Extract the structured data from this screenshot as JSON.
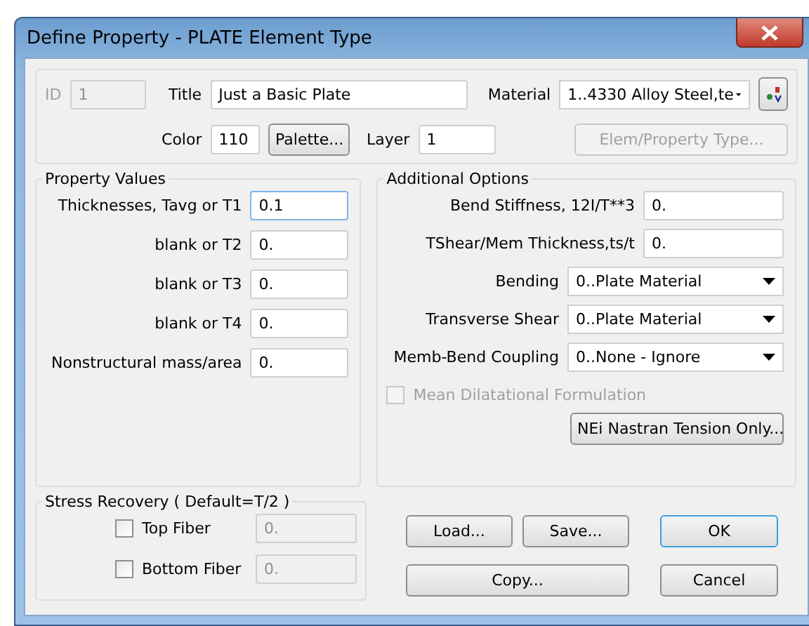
{
  "window": {
    "title": "Define Property - PLATE Element Type"
  },
  "header": {
    "id": {
      "label": "ID",
      "value": "1",
      "disabled": true
    },
    "title_field": {
      "label": "Title",
      "value": "Just a Basic Plate"
    },
    "material": {
      "label": "Material",
      "value": "1..4330 Alloy Steel,te"
    },
    "color": {
      "label": "Color",
      "value": "110"
    },
    "palette_button": {
      "label": "Palette..."
    },
    "layer": {
      "label": "Layer",
      "value": "1"
    },
    "elem_type_button": {
      "label": "Elem/Property Type...",
      "disabled": true
    }
  },
  "property_values": {
    "title": "Property Values",
    "fields": [
      {
        "label": "Thicknesses, Tavg or T1",
        "value": "0.1",
        "focused": true
      },
      {
        "label": "blank or T2",
        "value": "0.",
        "focused": false
      },
      {
        "label": "blank or T3",
        "value": "0.",
        "focused": false
      },
      {
        "label": "blank or T4",
        "value": "0.",
        "focused": false
      },
      {
        "label": "Nonstructural mass/area",
        "value": "0.",
        "focused": false
      }
    ]
  },
  "additional_options": {
    "title": "Additional Options",
    "fields": [
      {
        "kind": "text",
        "label": "Bend Stiffness,  12I/T**3",
        "value": "0."
      },
      {
        "kind": "text",
        "label": "TShear/Mem Thickness,ts/t",
        "value": "0."
      },
      {
        "kind": "select",
        "label": "Bending",
        "value": "0..Plate Material"
      },
      {
        "kind": "select",
        "label": "Transverse Shear",
        "value": "0..Plate Material"
      },
      {
        "kind": "select",
        "label": "Memb-Bend Coupling",
        "value": "0..None - Ignore"
      }
    ],
    "mean_dilatational": {
      "label": "Mean Dilatational Formulation",
      "checked": false,
      "disabled": true
    },
    "button": {
      "label": "NEi Nastran Tension Only..."
    }
  },
  "stress_recovery": {
    "title": "Stress Recovery ( Default=T/2 )",
    "fibers": [
      {
        "label": "Top Fiber",
        "checked": false,
        "value": "0."
      },
      {
        "label": "Bottom Fiber",
        "checked": false,
        "value": "0."
      }
    ]
  },
  "button_rows": [
    {
      "left": [
        {
          "label": "Load..."
        },
        {
          "label": "Save..."
        }
      ],
      "right": {
        "label": "OK",
        "default": true
      }
    },
    {
      "left": [
        {
          "label": "Copy..."
        }
      ],
      "right": {
        "label": "Cancel",
        "default": false
      }
    }
  ]
}
